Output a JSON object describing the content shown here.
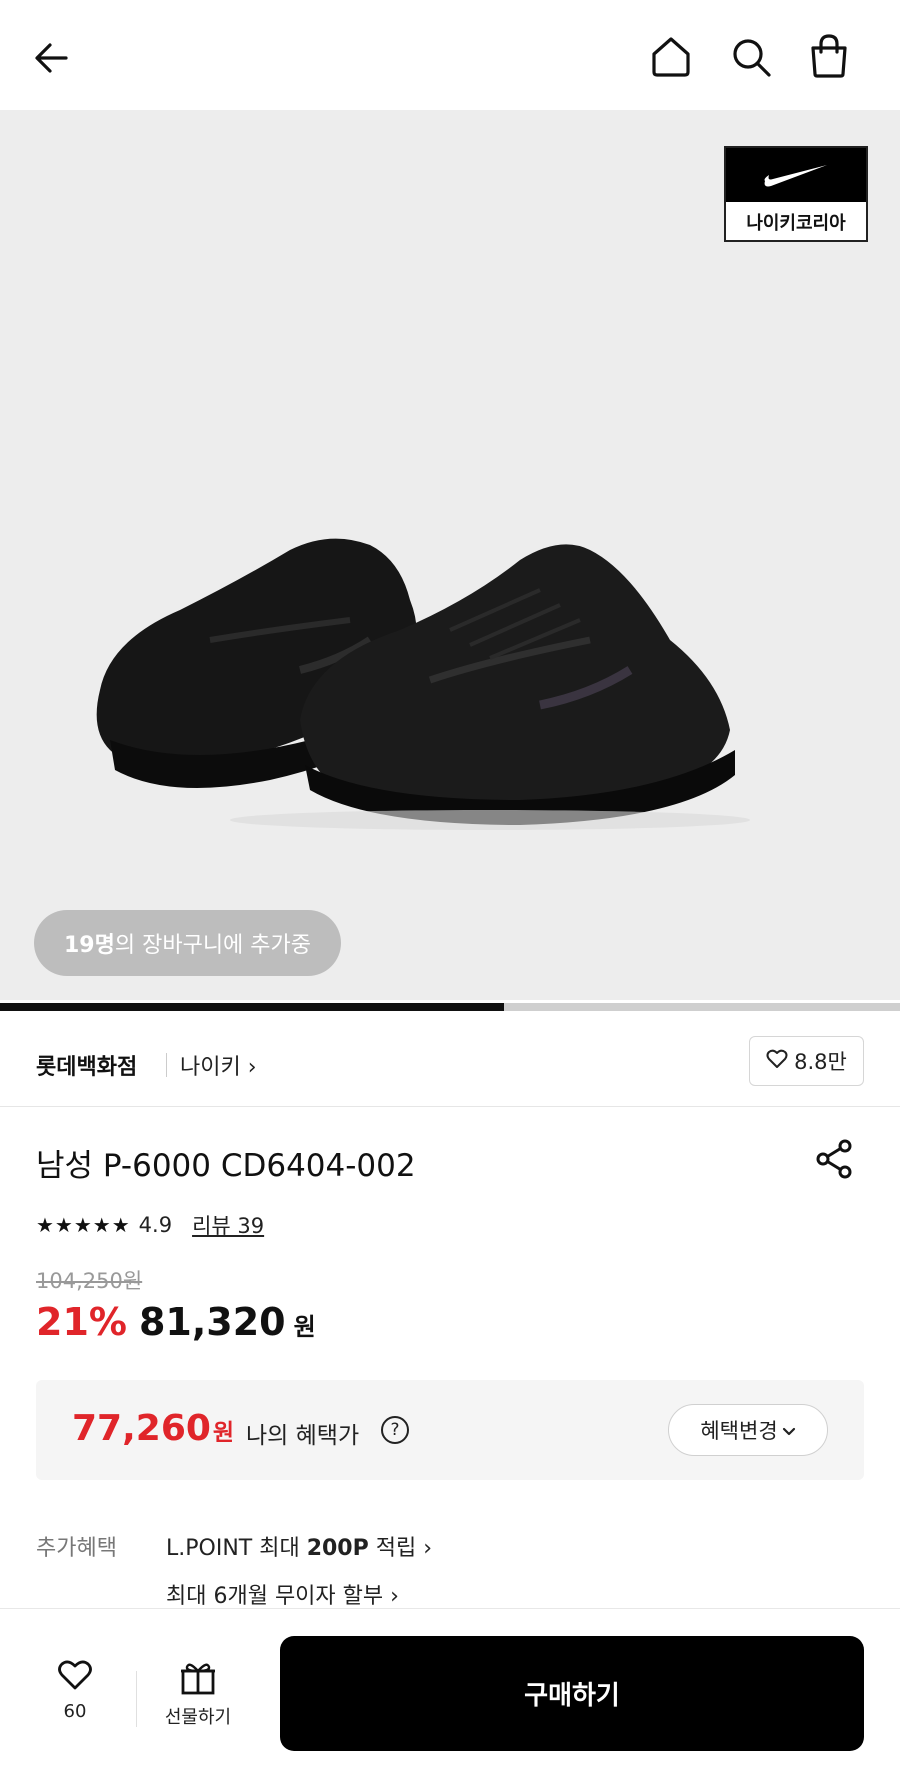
{
  "header": {
    "icons": [
      "back-arrow-icon",
      "home-icon",
      "search-icon",
      "shopping-bag-icon"
    ]
  },
  "hero": {
    "brand_badge_text": "나이키코리아",
    "cart_count": "19명",
    "cart_text": "의 장바구니에 추가중",
    "image_progress": 0.56
  },
  "brand_row": {
    "store": "롯데백화점",
    "brand": "나이키",
    "brand_chevron": "›",
    "like_count": "8.8만"
  },
  "product": {
    "title": "남성 P-6000 CD6404-002",
    "stars": "★★★★★",
    "score": "4.9",
    "review_label": "리뷰 39",
    "original_price": "104,250원",
    "discount_rate": "21%",
    "price": "81,320",
    "price_unit": "원"
  },
  "benefit": {
    "price": "77,260",
    "price_unit": "원",
    "label": "나의 혜택가",
    "help": "?",
    "change_label": "혜택변경",
    "change_chevron": "⌄"
  },
  "extra": {
    "label": "추가혜택",
    "line1_prefix": "L.POINT 최대 ",
    "line1_bold": "200P",
    "line1_suffix": " 적립 ›",
    "line2": "최대 6개월 무이자 할부 ›"
  },
  "bottom_bar": {
    "like_count": "60",
    "gift_label": "선물하기",
    "buy_label": "구매하기"
  },
  "colors": {
    "accent_red": "#e0252a",
    "buy_button": "#000000"
  }
}
